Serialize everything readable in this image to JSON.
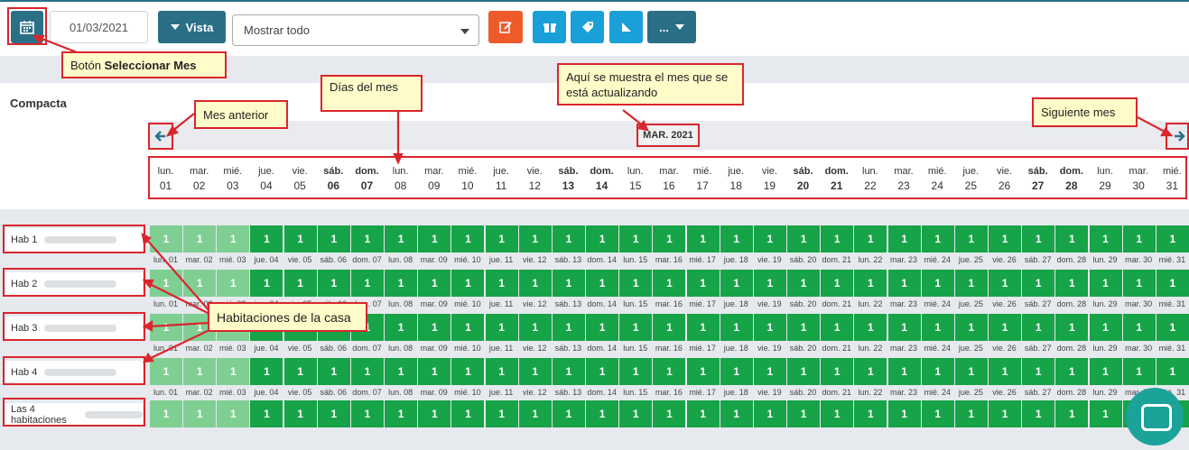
{
  "toolbar": {
    "date_value": "01/03/2021",
    "vista_label": "Vista",
    "select_value": "Mostrar todo",
    "more_label": "..."
  },
  "section_title": "Compacta",
  "month_label": "MAR. 2021",
  "days": [
    {
      "name": "lun.",
      "num": "01"
    },
    {
      "name": "mar.",
      "num": "02"
    },
    {
      "name": "mié.",
      "num": "03"
    },
    {
      "name": "jue.",
      "num": "04"
    },
    {
      "name": "vie.",
      "num": "05"
    },
    {
      "name": "sáb.",
      "num": "06"
    },
    {
      "name": "dom.",
      "num": "07"
    },
    {
      "name": "lun.",
      "num": "08"
    },
    {
      "name": "mar.",
      "num": "09"
    },
    {
      "name": "mié.",
      "num": "10"
    },
    {
      "name": "jue.",
      "num": "11"
    },
    {
      "name": "vie.",
      "num": "12"
    },
    {
      "name": "sáb.",
      "num": "13"
    },
    {
      "name": "dom.",
      "num": "14"
    },
    {
      "name": "lun.",
      "num": "15"
    },
    {
      "name": "mar.",
      "num": "16"
    },
    {
      "name": "mié.",
      "num": "17"
    },
    {
      "name": "jue.",
      "num": "18"
    },
    {
      "name": "vie.",
      "num": "19"
    },
    {
      "name": "sáb.",
      "num": "20"
    },
    {
      "name": "dom.",
      "num": "21"
    },
    {
      "name": "lun.",
      "num": "22"
    },
    {
      "name": "mar.",
      "num": "23"
    },
    {
      "name": "mié.",
      "num": "24"
    },
    {
      "name": "jue.",
      "num": "25"
    },
    {
      "name": "vie.",
      "num": "26"
    },
    {
      "name": "sáb.",
      "num": "27"
    },
    {
      "name": "dom.",
      "num": "28"
    },
    {
      "name": "lun.",
      "num": "29"
    },
    {
      "name": "mar.",
      "num": "30"
    },
    {
      "name": "mié.",
      "num": "31"
    }
  ],
  "sub_labels": [
    "lun. 01",
    "mar. 02",
    "mié. 03",
    "jue. 04",
    "vie. 05",
    "sáb. 06",
    "dom. 07",
    "lun. 08",
    "mar. 09",
    "mié. 10",
    "jue. 11",
    "vie. 12",
    "sáb. 13",
    "dom. 14",
    "lun. 15",
    "mar. 16",
    "mié. 17",
    "jue. 18",
    "vie. 19",
    "sáb. 20",
    "dom. 21",
    "lun. 22",
    "mar. 23",
    "mié. 24",
    "jue. 25",
    "vie. 26",
    "sáb. 27",
    "dom. 28",
    "lun. 29",
    "mar. 30",
    "mié. 31"
  ],
  "rooms": [
    "Hab 1",
    "Hab 2",
    "Hab 3",
    "Hab 4",
    "Las 4 habitaciones"
  ],
  "cell_value": "1",
  "annotations": {
    "select_month": "Botón ",
    "select_month_bold": "Seleccionar Mes",
    "prev_month": "Mes anterior",
    "days_of_month": "Días del mes",
    "current_month": "Aquí se muestra el mes que se está actualizando",
    "next_month": "Siguiente mes",
    "rooms": "Habitaciones de la casa"
  },
  "colors": {
    "primary": "#2b6f87",
    "orange": "#ef5a2b",
    "cyan": "#1aa0d8",
    "available": "#17a347",
    "available_past": "#7fcf93",
    "annotation_border": "#d9262e"
  }
}
